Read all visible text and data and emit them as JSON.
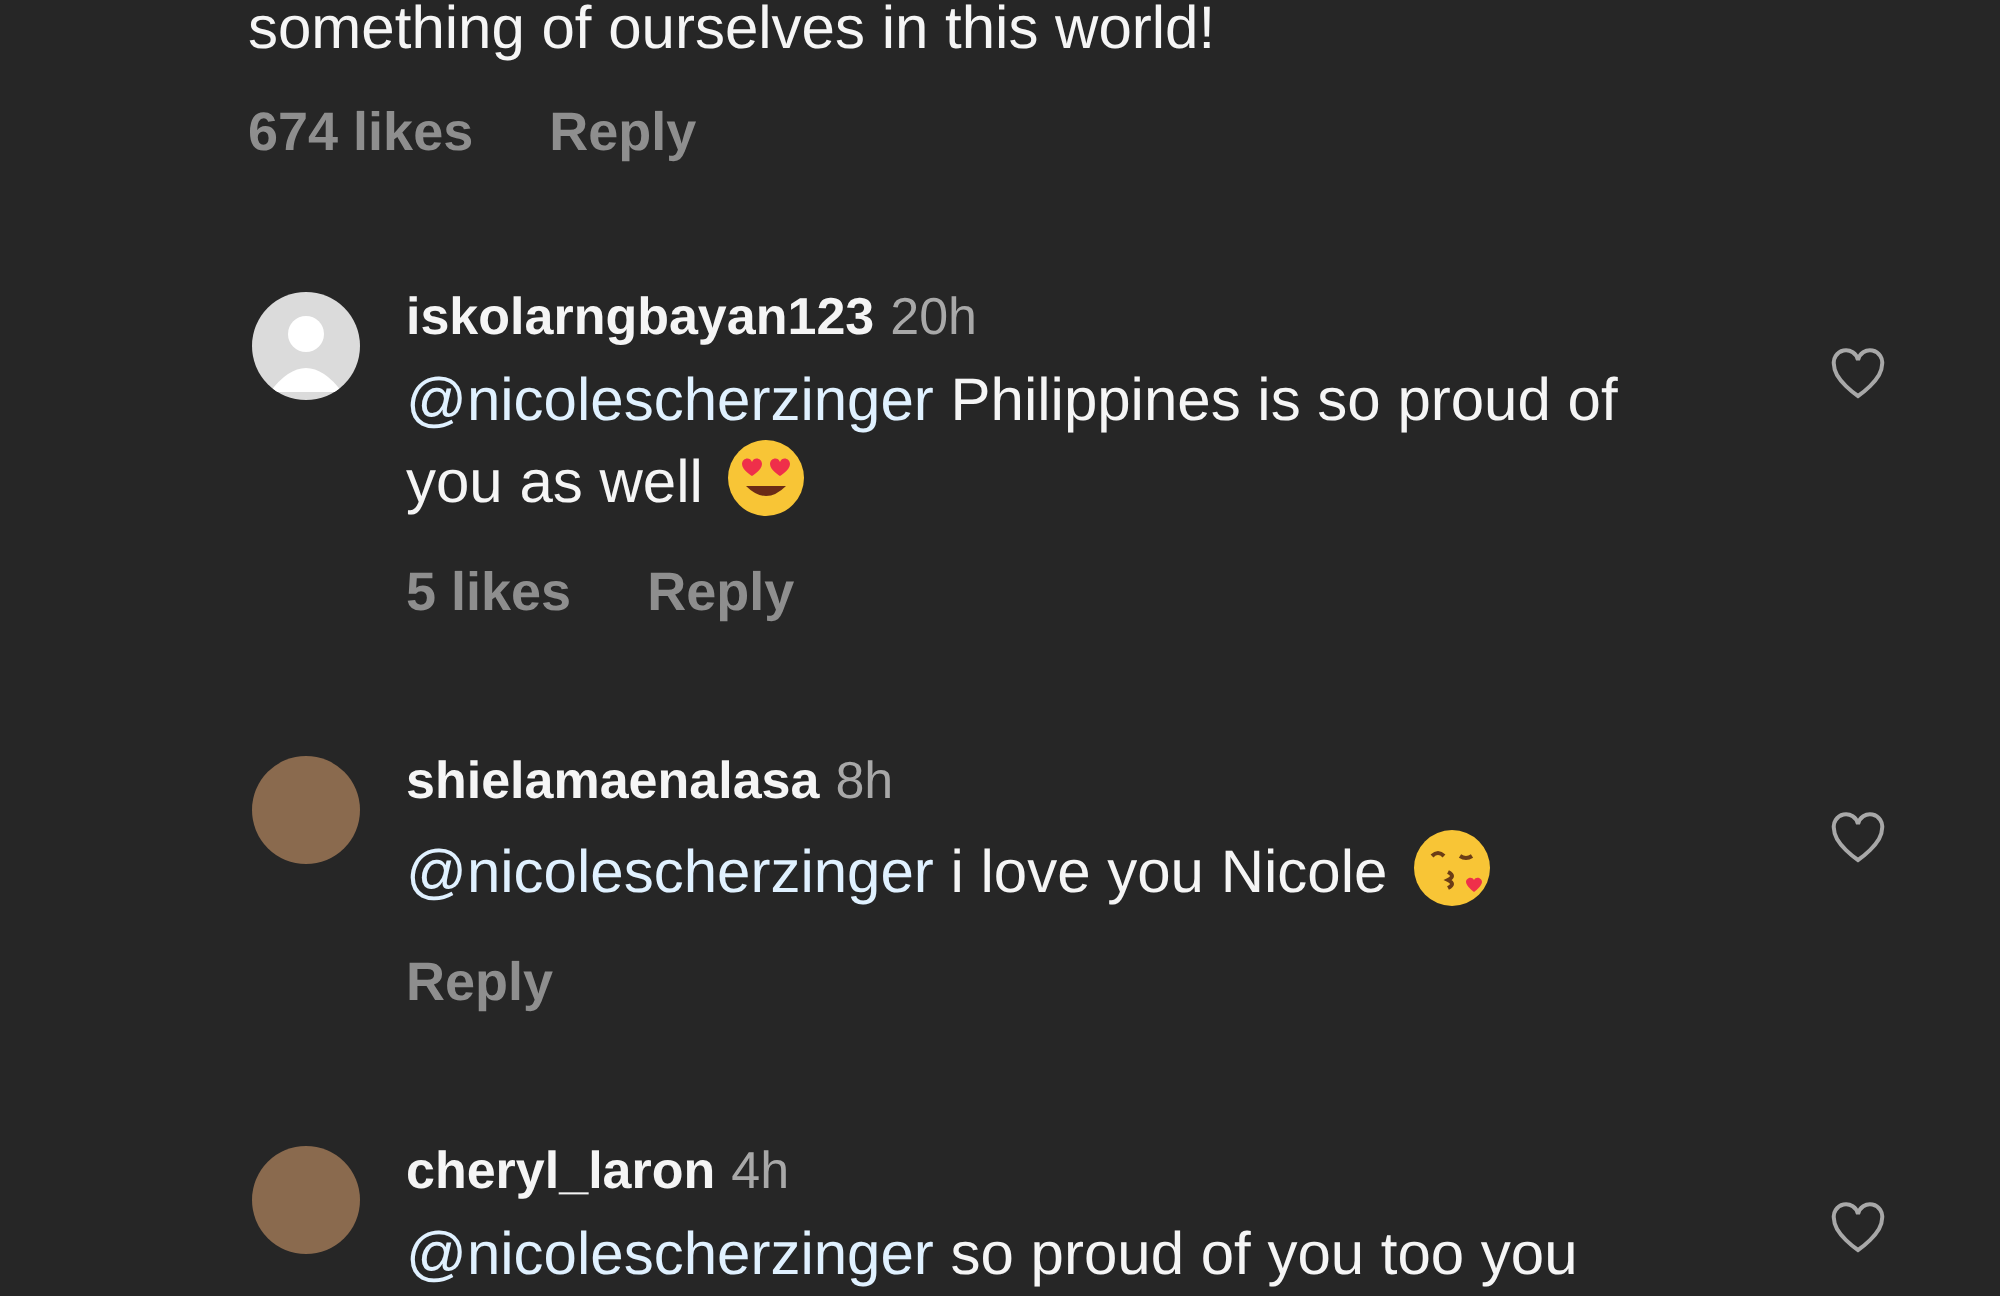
{
  "top_comment": {
    "text": "something of ourselves in this world!",
    "likes": "674 likes",
    "reply": "Reply"
  },
  "replies": [
    {
      "username": "iskolarngbayan123",
      "time": "20h",
      "avatar": {
        "kind": "default"
      },
      "mention": "@nicolescherzinger",
      "text": "Philippines is so proud of you as well",
      "emoji": {
        "kind": "heart_eyes"
      },
      "likes": "5 likes",
      "reply": "Reply",
      "liked": false
    },
    {
      "username": "shielamaenalasa",
      "time": "8h",
      "avatar": {
        "kind": "photo"
      },
      "mention": "@nicolescherzinger",
      "text": " i love you Nicole",
      "emoji": {
        "kind": "kiss"
      },
      "reply": "Reply",
      "liked": false
    },
    {
      "username": "cheryl_laron",
      "time": "4h",
      "avatar": {
        "kind": "photo"
      },
      "mention": "@nicolescherzinger",
      "text": "so proud of you too you",
      "liked": false
    }
  ]
}
